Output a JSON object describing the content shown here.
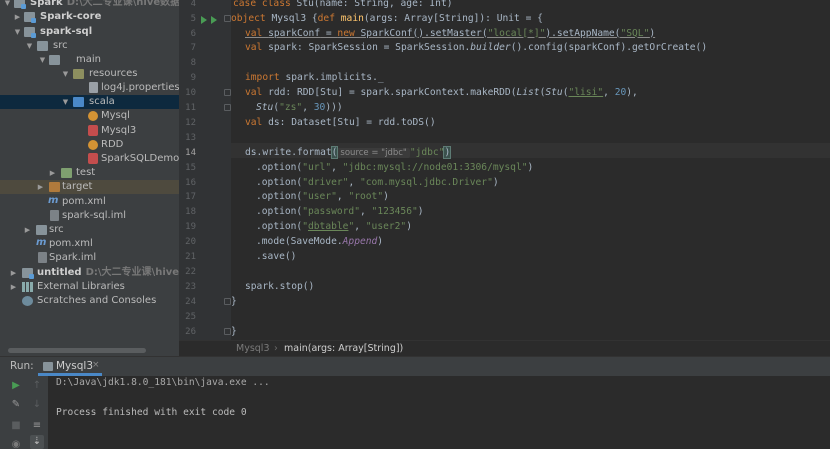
{
  "project_tree": {
    "rows": [
      {
        "label": "Spark",
        "path": "D:\\大二专业课\\hive数据仓库\\"
      },
      {
        "label": "Spark-core",
        "path": ""
      },
      {
        "label": "spark-sql",
        "path": ""
      },
      {
        "label": "src",
        "path": ""
      },
      {
        "label": "main",
        "path": ""
      },
      {
        "label": "resources",
        "path": ""
      },
      {
        "label": "log4j.properties",
        "path": ""
      },
      {
        "label": "scala",
        "path": ""
      },
      {
        "label": "Mysql",
        "path": ""
      },
      {
        "label": "Mysql3",
        "path": ""
      },
      {
        "label": "RDD",
        "path": ""
      },
      {
        "label": "SparkSQLDemo",
        "path": ""
      },
      {
        "label": "test",
        "path": ""
      },
      {
        "label": "target",
        "path": ""
      },
      {
        "label": "pom.xml",
        "path": ""
      },
      {
        "label": "spark-sql.iml",
        "path": ""
      },
      {
        "label": "src",
        "path": ""
      },
      {
        "label": "pom.xml",
        "path": ""
      },
      {
        "label": "Spark.iml",
        "path": ""
      },
      {
        "label": "untitled",
        "path": "D:\\大二专业课\\hive数据仓库"
      },
      {
        "label": "External Libraries",
        "path": ""
      },
      {
        "label": "Scratches and Consoles",
        "path": ""
      }
    ]
  },
  "editor": {
    "line_numbers": [
      "4",
      "5",
      "6",
      "7",
      "8",
      "9",
      "10",
      "11",
      "12",
      "13",
      "14",
      "15",
      "16",
      "17",
      "18",
      "19",
      "20",
      "21",
      "22",
      "23",
      "24",
      "25",
      "26"
    ],
    "inlay_hint": "source = \"jdbc\"",
    "breadcrumb": [
      "Mysql3",
      "main(args: Array[String])"
    ],
    "code": {
      "l4": {
        "a": "case class ",
        "b": "Stu",
        "c": "(name: String, age: Int)"
      },
      "l5": {
        "a": "object ",
        "b": "Mysql3 {",
        "c": "def ",
        "d": "main",
        "e": "(args: Array[",
        "f": "String",
        "g": "]): ",
        "h": "Unit",
        "i": " = {"
      },
      "l6": {
        "a": "val ",
        "b": "sparkConf",
        "c": " = ",
        "d": "new ",
        "e": "SparkConf().setMaster(",
        "f": "\"local[*]\"",
        "g": ").setAppName(",
        "h": "\"SQL\"",
        "i": ")"
      },
      "l7": {
        "a": "val ",
        "b": "spark: SparkSession = SparkSession.",
        "c": "builder",
        "d": "().config(sparkConf).getOrCreate()"
      },
      "l9": {
        "a": "import ",
        "b": "spark.implicits._"
      },
      "l10": {
        "a": "val ",
        "b": "rdd: RDD[Stu] = spark.sparkContext.makeRDD(",
        "c": "List",
        "d": "(",
        "e": "Stu",
        "f": "(",
        "g": "\"lisi\"",
        "h": ", ",
        "i": "20",
        "j": "),"
      },
      "l11": {
        "a": "Stu",
        "b": "(",
        "c": "\"zs\"",
        "d": ", ",
        "e": "30",
        "f": ")))"
      },
      "l12": {
        "a": "val ",
        "b": "ds: Dataset[Stu] = rdd.toDS()"
      },
      "l14": {
        "a": "ds.write.format",
        "b": "(",
        "c": "\"jdbc\"",
        "d": ")"
      },
      "l15": {
        "a": ".option(",
        "b": "\"url\"",
        "c": ", ",
        "d": "\"jdbc:mysql://node01:3306/mysql\"",
        "e": ")"
      },
      "l16": {
        "a": ".option(",
        "b": "\"driver\"",
        "c": ", ",
        "d": "\"com.mysql.jdbc.Driver\"",
        "e": ")"
      },
      "l17": {
        "a": ".option(",
        "b": "\"user\"",
        "c": ", ",
        "d": "\"root\"",
        "e": ")"
      },
      "l18": {
        "a": ".option(",
        "b": "\"password\"",
        "c": ", ",
        "d": "\"123456\"",
        "e": ")"
      },
      "l19": {
        "a": ".option(",
        "b": "\"",
        "c": "dbtable",
        "d": "\"",
        "e": ", ",
        "f": "\"user2\"",
        "g": ")"
      },
      "l20": {
        "a": ".mode(SaveMode.",
        "b": "Append",
        "c": ")"
      },
      "l21": {
        "a": ".save()"
      },
      "l23": {
        "a": "spark.stop()"
      },
      "l24": {
        "a": "}"
      },
      "l26": {
        "a": "}"
      }
    }
  },
  "run_panel": {
    "label": "Run:",
    "tab": "Mysql3",
    "tab_close": "×",
    "output": [
      "D:\\Java\\jdk1.8.0_181\\bin\\java.exe ...",
      "",
      "Process finished with exit code 0"
    ]
  },
  "colors": {
    "selection": "#0d293e",
    "accent": "#4a88c7",
    "run_green": "#499c54"
  }
}
